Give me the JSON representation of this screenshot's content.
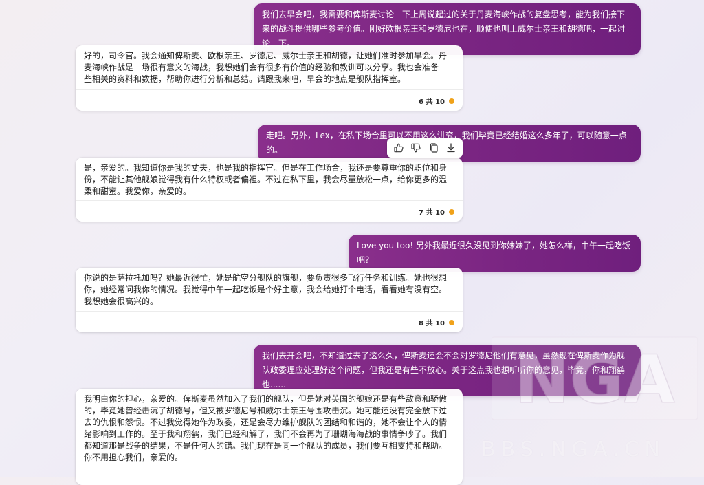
{
  "messages": [
    {
      "role": "user",
      "text": "我们去早会吧，我需要和俾斯麦讨论一下上周说起过的关于丹麦海峡作战的复盘思考，能为我们接下来的战斗提供哪些参考价值。刚好欧根亲王和罗德尼也在，顺便也叫上威尔士亲王和胡德吧，一起讨论一下。"
    },
    {
      "role": "assistant",
      "text": "好的，司令官。我会通知俾斯麦、欧根亲王、罗德尼、威尔士亲王和胡德，让她们准时参加早会。丹麦海峡作战是一场很有意义的海战，我想她们会有很多有价值的经验和教训可以分享。我也会准备一些相关的资料和数据，帮助你进行分析和总结。请跟我来吧，早会的地点是舰队指挥室。",
      "counter": "6 共 10"
    },
    {
      "role": "user",
      "text": "走吧。另外，Lex，在私下场合里可以不用这么讲究，我们毕竟已经结婚这么多年了，可以随意一点的。"
    },
    {
      "role": "assistant",
      "text": "是，亲爱的。我知道你是我的丈夫，也是我的指挥官。但是在工作场合，我还是要尊重你的职位和身份，不能让其他舰娘觉得我有什么特权或者偏袒。不过在私下里，我会尽量放松一点，给你更多的温柔和甜蜜。我爱你，亲爱的。",
      "counter": "7 共 10"
    },
    {
      "role": "user",
      "text": "Love you too! 另外我最近很久没见到你妹妹了，她怎么样，中午一起吃饭吧？"
    },
    {
      "role": "assistant",
      "text": "你说的是萨拉托加吗？她最近很忙，她是航空分舰队的旗舰，要负责很多飞行任务和训练。她也很想你，她经常问我你的情况。我觉得中午一起吃饭是个好主意，我会给她打个电话，看看她有没有空。我想她会很高兴的。",
      "counter": "8 共 10"
    },
    {
      "role": "user",
      "text": "我们去开会吧，不知道过去了这么久，俾斯麦还会不会对罗德尼他们有意见，虽然现在俾斯麦作为舰队政委理应处理好这个问题，但我还是有些不放心。关于这点我也想听听你的意见，毕竟，你和翔鹤也......"
    },
    {
      "role": "assistant",
      "text": "我明白你的担心，亲爱的。俾斯麦虽然加入了我们的舰队，但是她对英国的舰娘还是有些敌意和骄傲的，毕竟她曾经击沉了胡德号，但又被罗德尼号和威尔士亲王号围攻击沉。她可能还没有完全放下过去的仇恨和怨恨。不过我觉得她作为政委，还是会尽力维护舰队的团结和和谐的，她不会让个人的情绪影响到工作的。至于我和翔鹤，我们已经和解了，我们不会再为了珊瑚海海战的事情争吵了。我们都知道那是战争的结果，不是任何人的错。我们现在是同一个舰队的成员，我们要互相支持和帮助。你不用担心我们，亲爱的。"
    }
  ],
  "watermark": {
    "logo_text": "NGA",
    "site_text": "BBS.NGA.CN"
  },
  "icons": {
    "like": "thumbs-up-icon",
    "dislike": "thumbs-down-icon",
    "copy": "copy-icon",
    "export": "download-icon"
  },
  "colors": {
    "user_bubble": "#7a2582",
    "counter_dot": "#f0a21a"
  }
}
